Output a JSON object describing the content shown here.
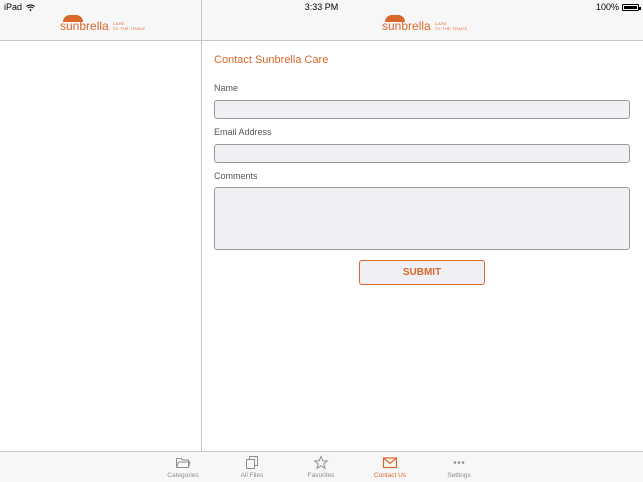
{
  "status_bar": {
    "device": "iPad",
    "time": "3:33 PM",
    "battery": "100%"
  },
  "logo": {
    "brand": "sunbrella",
    "tagline_1": "CARE",
    "tagline_2": "TO THE TRADE",
    "color": "#d9682a"
  },
  "form": {
    "title": "Contact Sunbrella Care",
    "name_label": "Name",
    "name_value": "",
    "email_label": "Email Address",
    "email_value": "",
    "comments_label": "Comments",
    "comments_value": "",
    "submit_label": "SUBMIT"
  },
  "tabs": [
    {
      "label": "Categories",
      "icon": "folder-icon",
      "active": false
    },
    {
      "label": "All Files",
      "icon": "files-icon",
      "active": false
    },
    {
      "label": "Favorites",
      "icon": "star-icon",
      "active": false
    },
    {
      "label": "Contact Us",
      "icon": "envelope-icon",
      "active": true
    },
    {
      "label": "Settings",
      "icon": "more-icon",
      "active": false
    }
  ],
  "colors": {
    "accent": "#d9682a",
    "field_bg": "#efeff4",
    "bar_bg": "#f7f7f7",
    "inactive_tab": "#8e8e93"
  }
}
